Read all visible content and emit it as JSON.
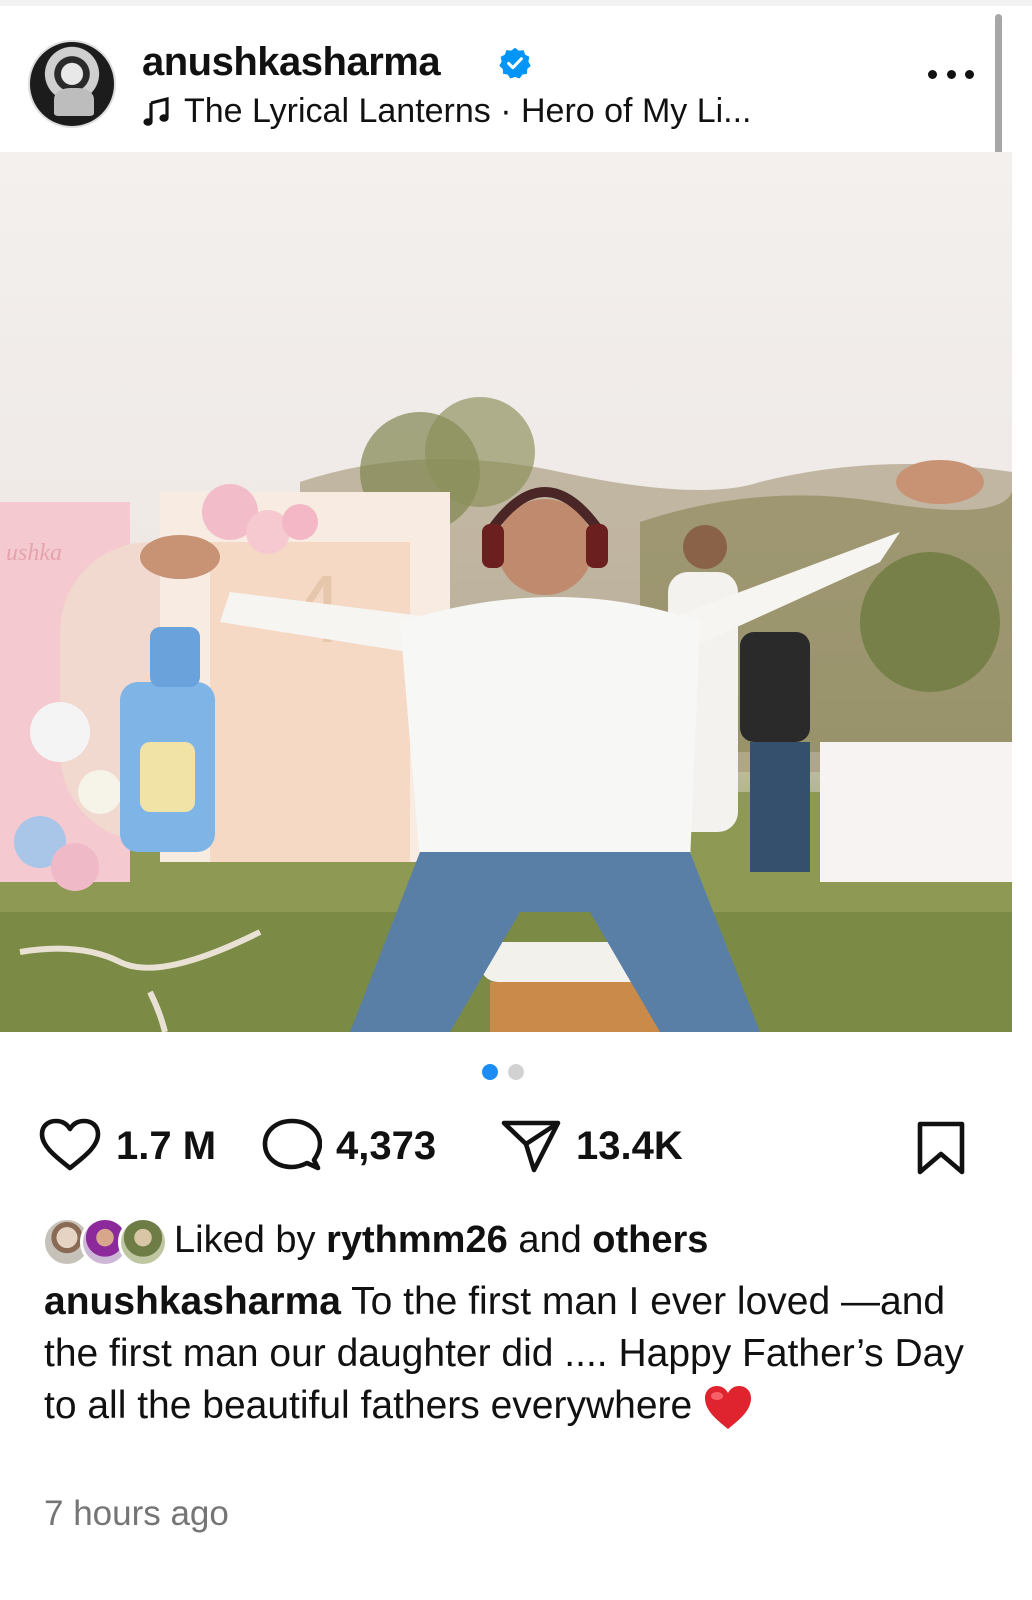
{
  "post": {
    "username": "anushkasharma",
    "verified": true,
    "audio": "The Lyrical Lanterns · Hero of My Li...",
    "media": {
      "type": "photo",
      "description_icon": "photo",
      "carousel_count": 2,
      "carousel_active": 1,
      "muted": true,
      "overlay_text": {
        "sign": "ushka",
        "number": "4"
      }
    },
    "stats": {
      "likes": "1.7 M",
      "comments": "4,373",
      "shares": "13.4K"
    },
    "liked_by": {
      "prefix": "Liked by",
      "user": "rythmm26",
      "middle": "and",
      "suffix": "others"
    },
    "caption": "To the first man I ever loved —and the first man our daughter did .... Happy Father’s Day to all the beautiful fathers everywhere",
    "caption_emoji": "red-heart",
    "timestamp": "7 hours ago"
  },
  "colors": {
    "accent_blue": "#1a8df5",
    "verified_blue": "#0095f6",
    "text_secondary": "#757575"
  }
}
